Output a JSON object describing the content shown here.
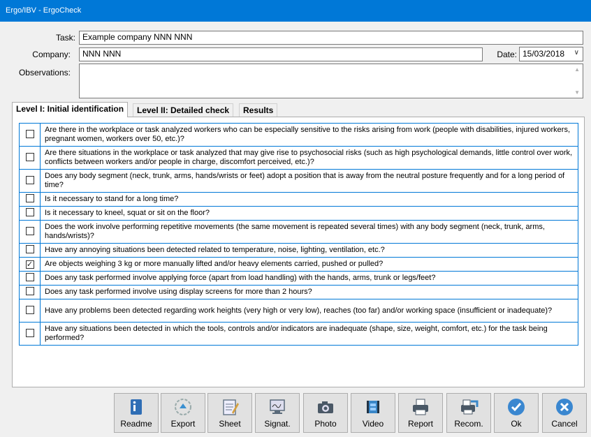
{
  "window": {
    "title": "Ergo/IBV - ErgoCheck"
  },
  "form": {
    "task_label": "Task:",
    "task_value": "Example company NNN NNN",
    "company_label": "Company:",
    "company_value": "NNN NNN",
    "date_label": "Date:",
    "date_value": "15/03/2018",
    "observations_label": "Observations:",
    "observations_value": ""
  },
  "tabs": [
    {
      "label": "Level I: Initial identification",
      "active": true
    },
    {
      "label": "Level II: Detailed check",
      "active": false
    },
    {
      "label": "Results",
      "active": false
    }
  ],
  "questions": [
    {
      "text": "Are there in the workplace or task analyzed workers who can be especially sensitive to the risks arising from work (people with disabilities, injured workers, pregnant women, workers over 50, etc.)?",
      "checked": false
    },
    {
      "text": "Are there situations in the workplace or task analyzed that may give rise to psychosocial risks (such as high psychological demands, little control over work, conflicts between workers and/or people in charge, discomfort perceived, etc.)?",
      "checked": false
    },
    {
      "text": "Does any body segment (neck, trunk, arms, hands/wrists or feet) adopt a position that is away from the neutral posture frequently and for a long period of time?",
      "checked": false
    },
    {
      "text": "Is it necessary to stand for a long time?",
      "checked": false
    },
    {
      "text": "Is it necessary to kneel, squat or sit on the floor?",
      "checked": false
    },
    {
      "text": "Does the work involve performing repetitive movements (the same movement is repeated several times) with any body segment (neck, trunk, arms, hands/wrists)?",
      "checked": false
    },
    {
      "text": "Have any annoying situations been detected related to temperature, noise, lighting, ventilation, etc.?",
      "checked": false
    },
    {
      "text": "Are objects weighing 3 kg or more manually lifted and/or heavy elements carried, pushed or pulled?",
      "checked": true
    },
    {
      "text": "Does any task performed involve applying force (apart from load handling) with the hands, arms, trunk or legs/feet?",
      "checked": false
    },
    {
      "text": "Does any task performed involve using display screens for more than 2 hours?",
      "checked": false
    },
    {
      "text": "Have any problems been detected regarding work heights (very high or very low), reaches (too far) and/or working space (insufficient or inadequate)?",
      "checked": false
    },
    {
      "text": "Have any situations been detected in which the tools, controls and/or indicators are inadequate (shape, size, weight, comfort, etc.) for the task being performed?",
      "checked": false
    }
  ],
  "toolbar": [
    {
      "label": "Readme",
      "icon": "readme-icon",
      "color": "#2f6eb5"
    },
    {
      "label": "Export",
      "icon": "export-icon",
      "color": "#3a8fd0"
    },
    {
      "label": "Sheet",
      "icon": "sheet-icon",
      "color": "#6a7a8a"
    },
    {
      "label": "Signat.",
      "icon": "signature-icon",
      "color": "#5a6a7a"
    },
    {
      "label": "Photo",
      "icon": "camera-icon",
      "color": "#4a5866"
    },
    {
      "label": "Video",
      "icon": "video-icon",
      "color": "#3a87c8"
    },
    {
      "label": "Report",
      "icon": "printer-icon",
      "color": "#4a5866"
    },
    {
      "label": "Recom.",
      "icon": "recommendations-icon",
      "color": "#3a87c8"
    },
    {
      "label": "Ok",
      "icon": "check-icon",
      "color": "#3a87d0"
    },
    {
      "label": "Cancel",
      "icon": "cancel-icon",
      "color": "#3a87d0"
    }
  ]
}
